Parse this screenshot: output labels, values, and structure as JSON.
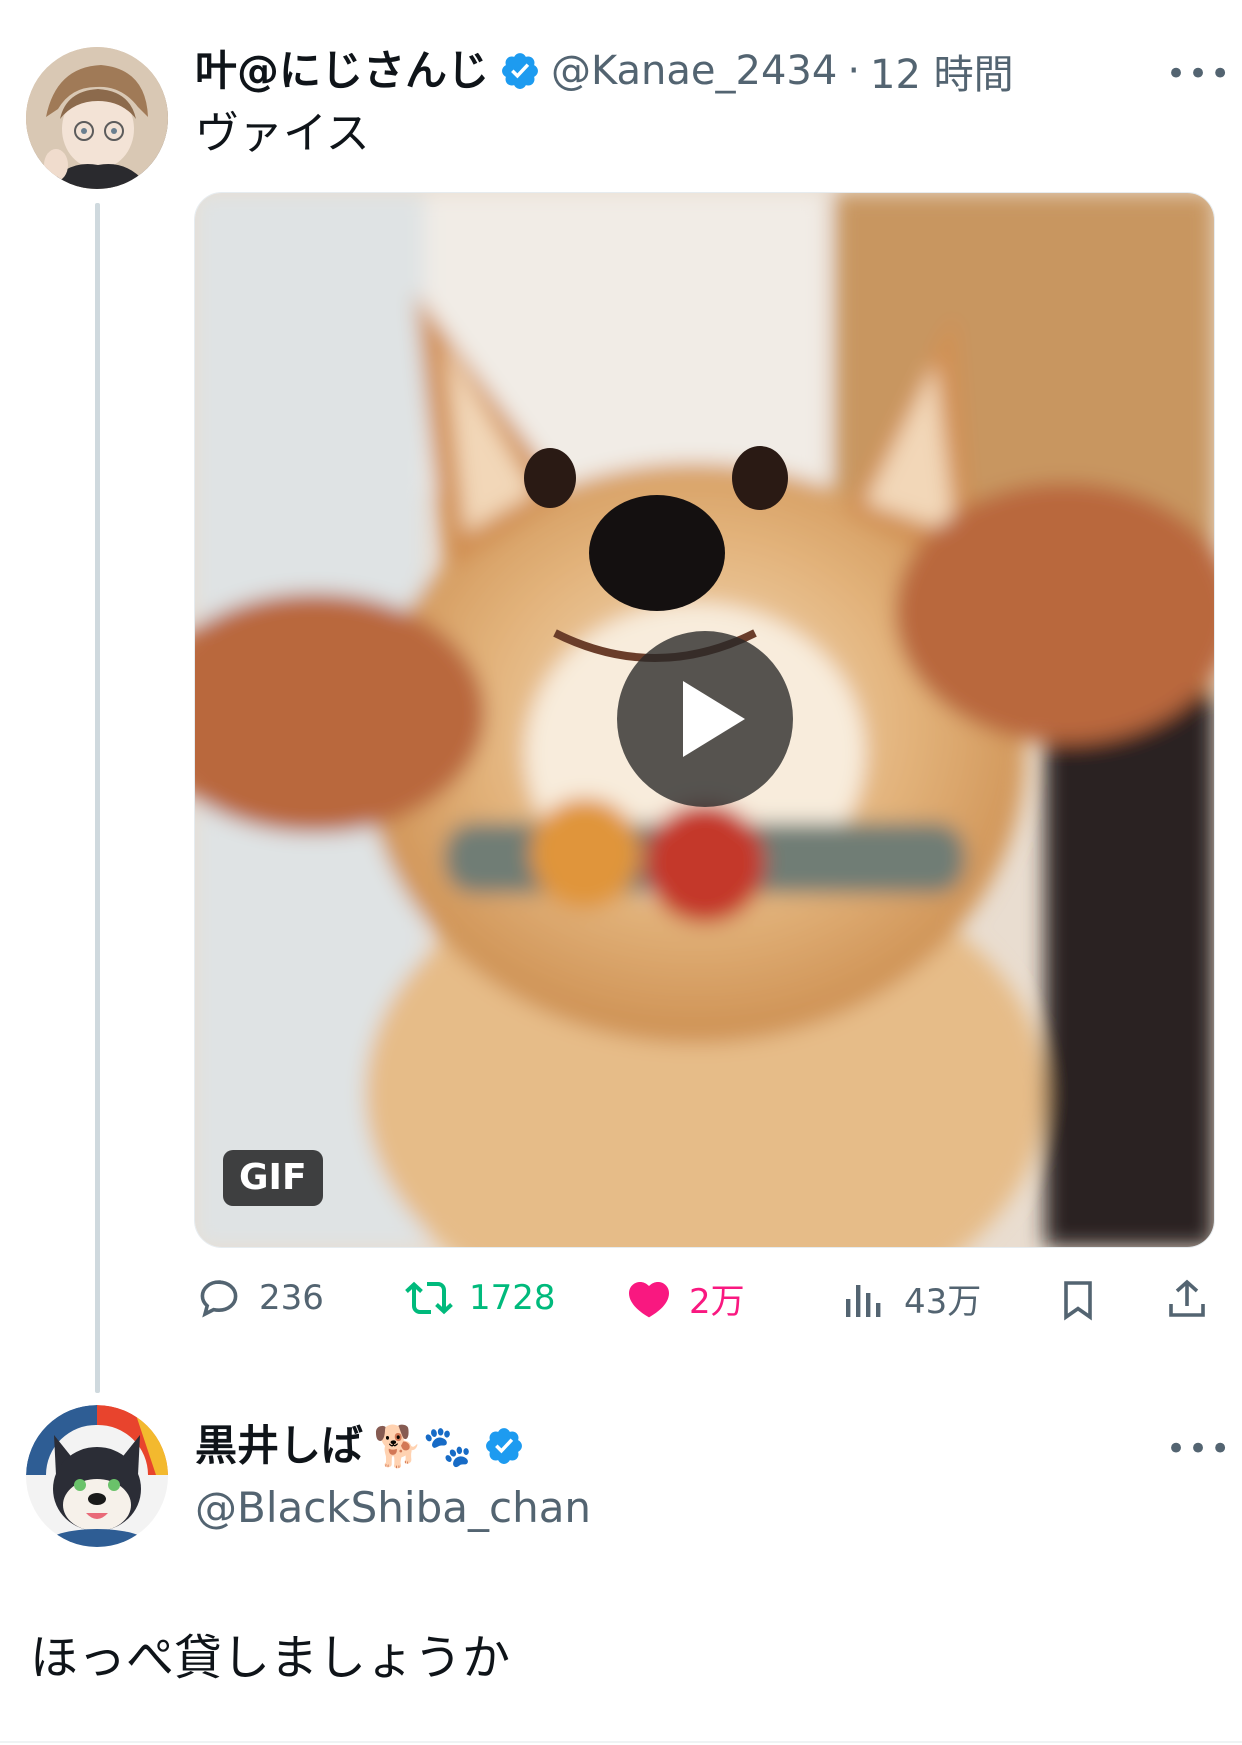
{
  "tweet": {
    "display_name": "叶@にじさんじ",
    "handle": "@Kanae_2434",
    "separator": "·",
    "time": "12 時間",
    "more": "•••",
    "text": "ヴァイス",
    "media_badge": "GIF",
    "media": "dog-gif"
  },
  "stats": {
    "replies": "236",
    "retweets": "1728",
    "likes": "2万",
    "views": "43万"
  },
  "reply": {
    "display_name": "黒井しば",
    "name_emoji": "🐕🐾",
    "handle": "@BlackShiba_chan",
    "more": "•••",
    "text": "ほっぺ貸しましょうか"
  },
  "colors": {
    "verified": "#1d9bf0",
    "retweet_active": "#00ba7c",
    "like_active": "#f91880",
    "muted": "#536471"
  },
  "icons": [
    "verified-badge-icon",
    "more-icon",
    "play-icon",
    "reply-icon",
    "retweet-icon",
    "like-icon",
    "views-icon",
    "bookmark-icon",
    "share-icon"
  ]
}
